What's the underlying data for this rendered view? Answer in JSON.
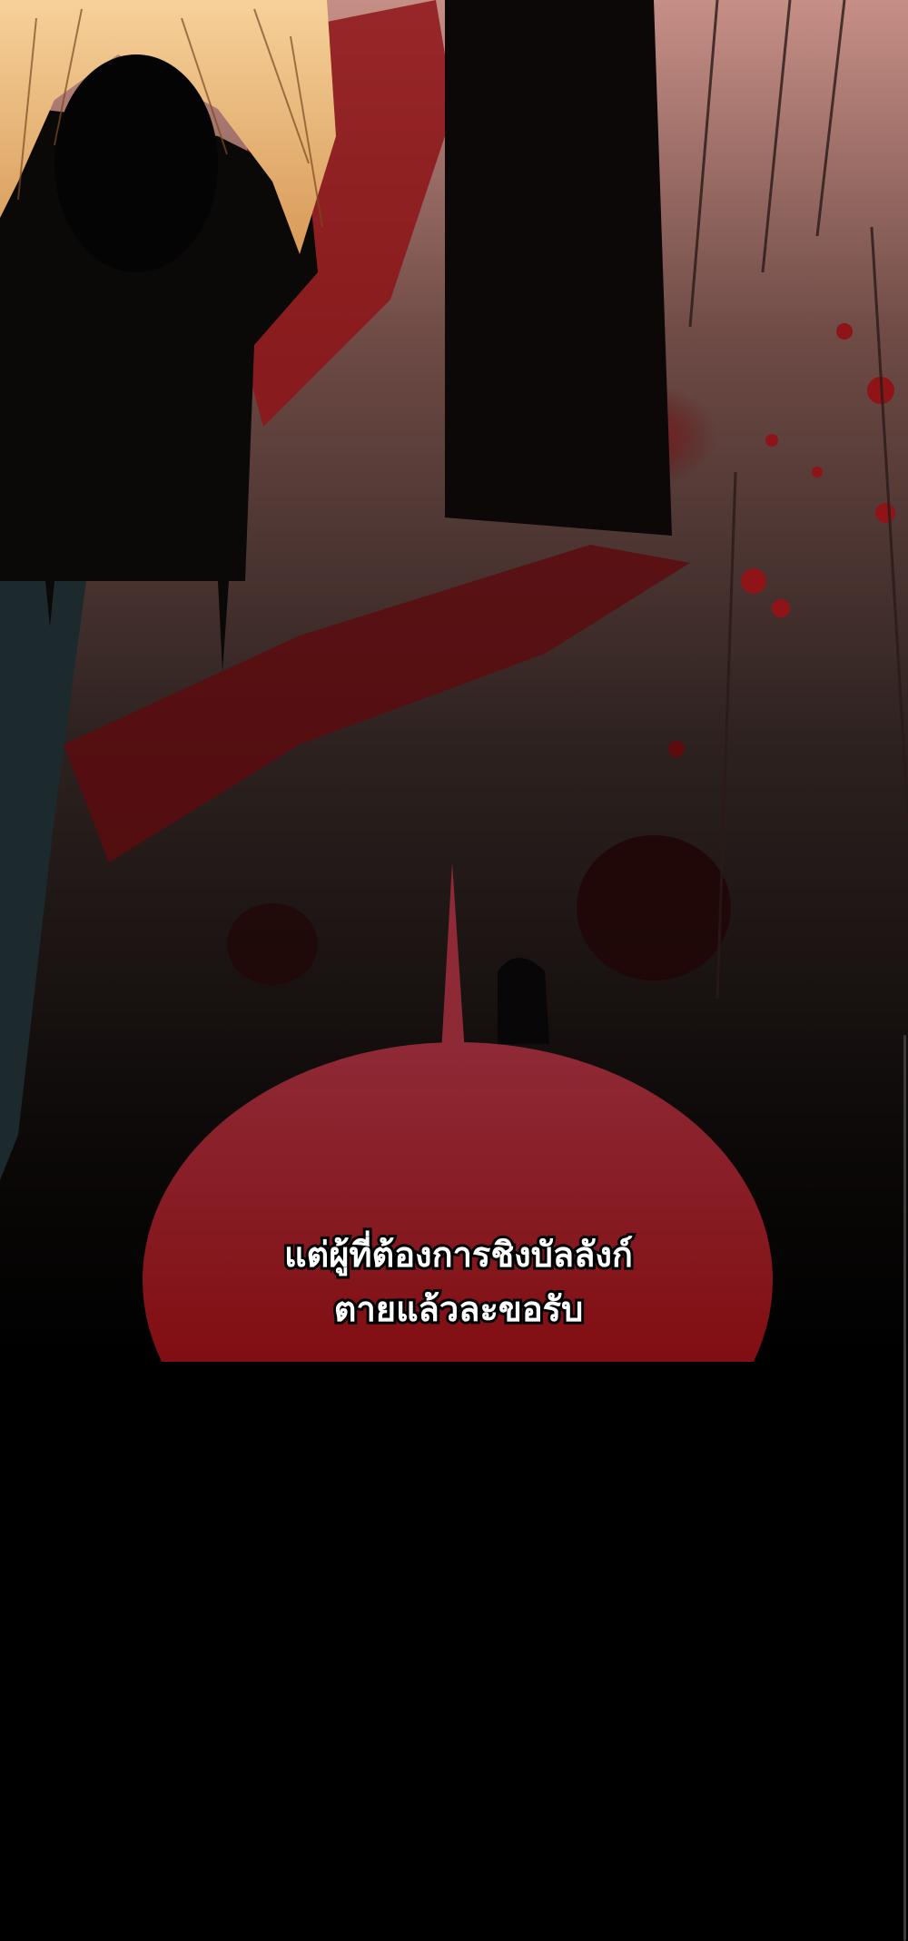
{
  "panel": {
    "dialogue": {
      "line1": "แต่ผู้ที่ต้องการชิงบัลลังก์",
      "line2": "ตายแล้วละขอรับ"
    }
  },
  "colors": {
    "bubble_top": "#8e2a36",
    "bubble_bottom": "#7a0000",
    "blood": "#7a0f12",
    "background": "#000000"
  }
}
